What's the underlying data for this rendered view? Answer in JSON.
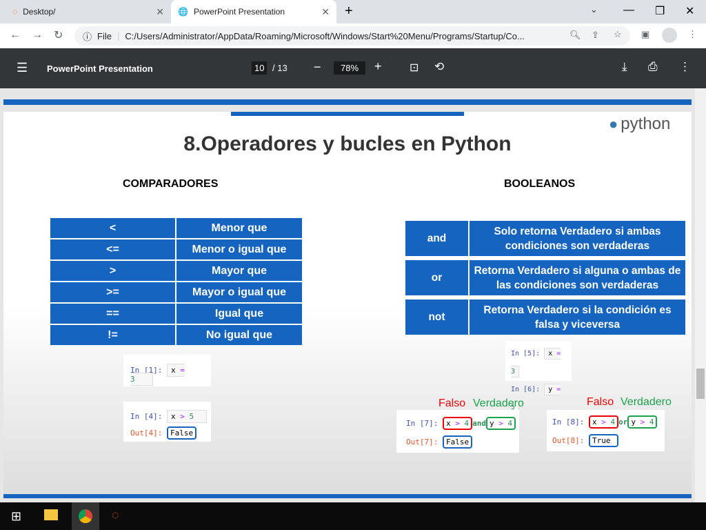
{
  "browser": {
    "tabs": [
      {
        "label": "Desktop/"
      },
      {
        "label": "PowerPoint Presentation"
      }
    ],
    "url_prefix": "File",
    "url": "C:/Users/Administrator/AppData/Roaming/Microsoft/Windows/Start%20Menu/Programs/Startup/Co..."
  },
  "pdf": {
    "title": "PowerPoint Presentation",
    "page": "10",
    "total": "/ 13",
    "zoom": "78%"
  },
  "slide": {
    "title": "8.Operadores y bucles en Python",
    "logo": "python",
    "left_heading": "COMPARADORES",
    "right_heading": "BOOLEANOS",
    "comparators": [
      [
        "<",
        "Menor que"
      ],
      [
        "<=",
        "Menor o igual que"
      ],
      [
        ">",
        "Mayor que"
      ],
      [
        ">=",
        "Mayor o igual que"
      ],
      [
        "==",
        "Igual que"
      ],
      [
        "!=",
        "No igual que"
      ]
    ],
    "booleans": [
      [
        "and",
        "Solo retorna Verdadero si ambas condiciones son verdaderas"
      ],
      [
        "or",
        "Retorna Verdadero si alguna o ambas de las condiciones son verdaderas"
      ],
      [
        "not",
        "Retorna Verdadero si la condición es falsa y viceversa"
      ]
    ],
    "code": {
      "in1": "In [1]:",
      "in4": "In [4]:",
      "out4": "Out[4]:",
      "false": "False",
      "true": "True",
      "in5": "In [5]:",
      "in6": "In [6]:",
      "in7": "In [7]:",
      "out7": "Out[7]:",
      "in8": "In [8]:",
      "out8": "Out[8]:",
      "x": "x",
      "y": "y",
      "eq": "=",
      "gt": ">",
      "n3": "3",
      "n5": "5",
      "n4": "4",
      "and": "and",
      "or": "or"
    },
    "falso": "Falso",
    "verdadero": "Verdadero"
  }
}
